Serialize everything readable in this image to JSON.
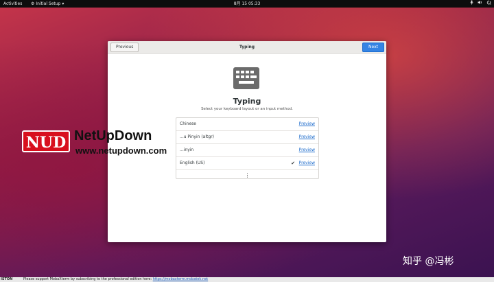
{
  "topbar": {
    "activities": "Activities",
    "app_name": "Initial Setup",
    "app_menu_arrow": "▾",
    "clock": "8月 15  05:33",
    "tray_icons": [
      "microphone-icon",
      "volume-icon",
      "power-icon"
    ]
  },
  "dialog": {
    "title": "Typing",
    "previous_label": "Previous",
    "next_label": "Next",
    "heading": "Typing",
    "subtitle": "Select your keyboard layout or an input method.",
    "icon": "keyboard-icon",
    "accent": "#3584e4",
    "layouts": [
      {
        "name": "Chinese",
        "selected": false,
        "preview": "Preview"
      },
      {
        "name": "...u Pinyin (altgr)",
        "selected": false,
        "preview": "Preview"
      },
      {
        "name": "...inyin",
        "selected": false,
        "preview": "Preview"
      },
      {
        "name": "English (US)",
        "selected": true,
        "preview": "Preview"
      }
    ],
    "more_glyph": "⋮"
  },
  "watermark": {
    "logo_text": "NUD",
    "title": "NetUpDown",
    "url": "www.netupdown.com",
    "brand_color": "#d8101e"
  },
  "zhihu_watermark": "知乎 @冯彬",
  "bottombar": {
    "left": "ISTON",
    "message": "Please support MobaXterm by subscribing to the professional edition here:",
    "link": "https://mobaxterm.mobatek.net"
  }
}
